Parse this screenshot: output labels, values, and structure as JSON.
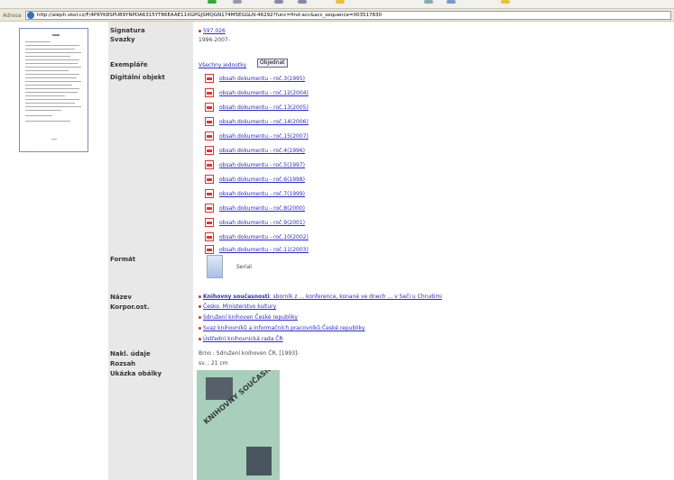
{
  "browser": {
    "address_label": "Adresa",
    "url": "http://aleph.vkol.cz/F/4PKYK8SPU89YNPDA6315YT86EAAE11XGPGJSMQGN174M5EGGLN-46292?func=find-acc&acc_sequence=003517830"
  },
  "record": {
    "labels": {
      "signatura": "Signatura",
      "svazky": "Svazky",
      "exemplare": "Exempláře",
      "digitalni": "Digitální objekt",
      "format": "Formát",
      "nazev": "Název",
      "korpor": "Korpor.ost.",
      "nakl": "Nakl. údaje",
      "rozsah": "Rozsah",
      "ukazka": "Ukázka obálky"
    },
    "signatura_value": "597.026",
    "svazky_value": "1996-2007-",
    "exemplare_link": "Všechny jednotky",
    "order_button": "Objednat",
    "digital_objects": [
      "obsah dokumentu - roč.3(1995)",
      "obsah dokumentu - roč.12(2004)",
      "obsah dokumentu - roč.13(2005)",
      "obsah dokumentu - roč.14(2006)",
      "obsah dokumentu - roč.15(2007)",
      "obsah dokumentu - roč.4(1996)",
      "obsah dokumentu - roč.5(1997)",
      "obsah dokumentu - roč.6(1998)",
      "obsah dokumentu - roč.7(1999)",
      "obsah dokumentu - roč.8(2000)",
      "obsah dokumentu - roč.9(2001)",
      "obsah dokumentu - roč.10(2002)",
      "obsah dokumentu - roč.11(2003)"
    ],
    "format_value": "Serial",
    "nazev_link": "Knihovny současnosti",
    "nazev_rest": ": sborník z ... konference, konané ve dnech ... v Seči u Chrudimi",
    "korpor": [
      "Česko. Ministerstvo kultury",
      "Sdružení knihoven České republiky",
      "Svaz knihovníků a informačních pracovníků České republiky",
      "Ústřední knihovnická rada ČR"
    ],
    "nakl_value": "Brno : Sdružení knihoven ČR, [1993]-",
    "rozsah_value": "sv. ; 21 cm",
    "cover_title": "KNIHOVNY SOUČASNOSTI"
  }
}
